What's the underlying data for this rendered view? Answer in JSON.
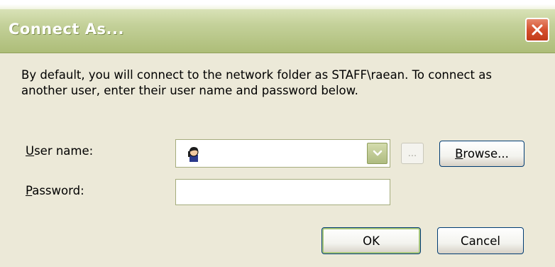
{
  "window": {
    "title": "Connect As...",
    "close_icon": "close-icon"
  },
  "message": "By default, you will connect to the network folder as STAFF\\raean. To connect as another user, enter their user name and password below.",
  "form": {
    "username_label_accel": "U",
    "username_label_rest": "ser name:",
    "username_value": "",
    "user_icon": "user-icon",
    "dropdown_icon": "chevron-down-icon",
    "ellipsis_label": "...",
    "browse_label_accel": "B",
    "browse_label_rest": "rowse...",
    "password_label_accel": "P",
    "password_label_rest": "assword:",
    "password_value": ""
  },
  "buttons": {
    "ok": "OK",
    "cancel": "Cancel"
  },
  "colors": {
    "title_bar": "#b7c486",
    "close_button": "#d5502e",
    "dialog_body": "#ece9d8",
    "default_button_border": "#a8c77a"
  }
}
